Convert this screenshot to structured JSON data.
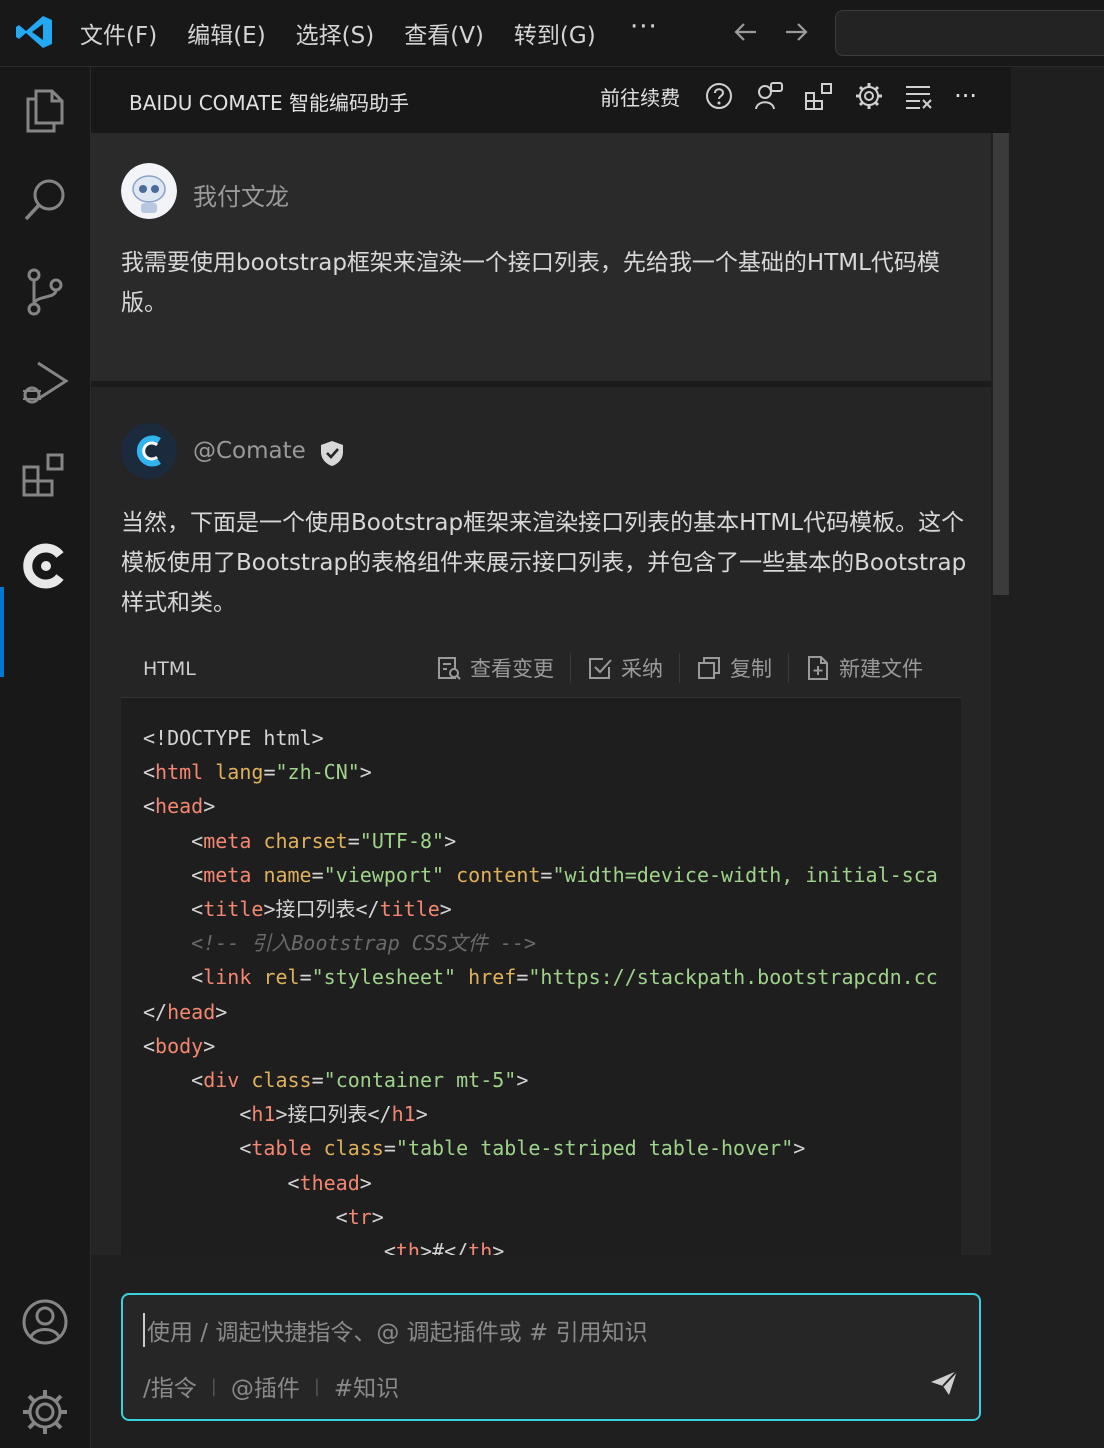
{
  "menu": {
    "items": [
      "文件(F)",
      "编辑(E)",
      "选择(S)",
      "查看(V)",
      "转到(G)"
    ],
    "more": "···"
  },
  "panel": {
    "title": "BAIDU COMATE 智能编码助手",
    "renew": "前往续费",
    "more": "···"
  },
  "user_message": {
    "name": "我付文龙",
    "text": "我需要使用bootstrap框架来渲染一个接口列表，先给我一个基础的HTML代码模版。"
  },
  "bot_message": {
    "name": "@Comate",
    "text": "当然，下面是一个使用Bootstrap框架来渲染接口列表的基本HTML代码模板。这个模板使用了Bootstrap的表格组件来展示接口列表，并包含了一些基本的Bootstrap样式和类。"
  },
  "code_block": {
    "language": "HTML",
    "actions": [
      "查看变更",
      "采纳",
      "复制",
      "新建文件"
    ]
  },
  "input": {
    "placeholder": "使用 / 调起快捷指令、@ 调起插件或 # 引用知识",
    "tools": [
      "/指令",
      "@插件",
      "#知识"
    ]
  },
  "colors": {
    "accent": "#0078d4",
    "input_border": "#3ad0dd",
    "tag": "#f48771",
    "attr": "#e0b15b",
    "string": "#9fd38b"
  }
}
